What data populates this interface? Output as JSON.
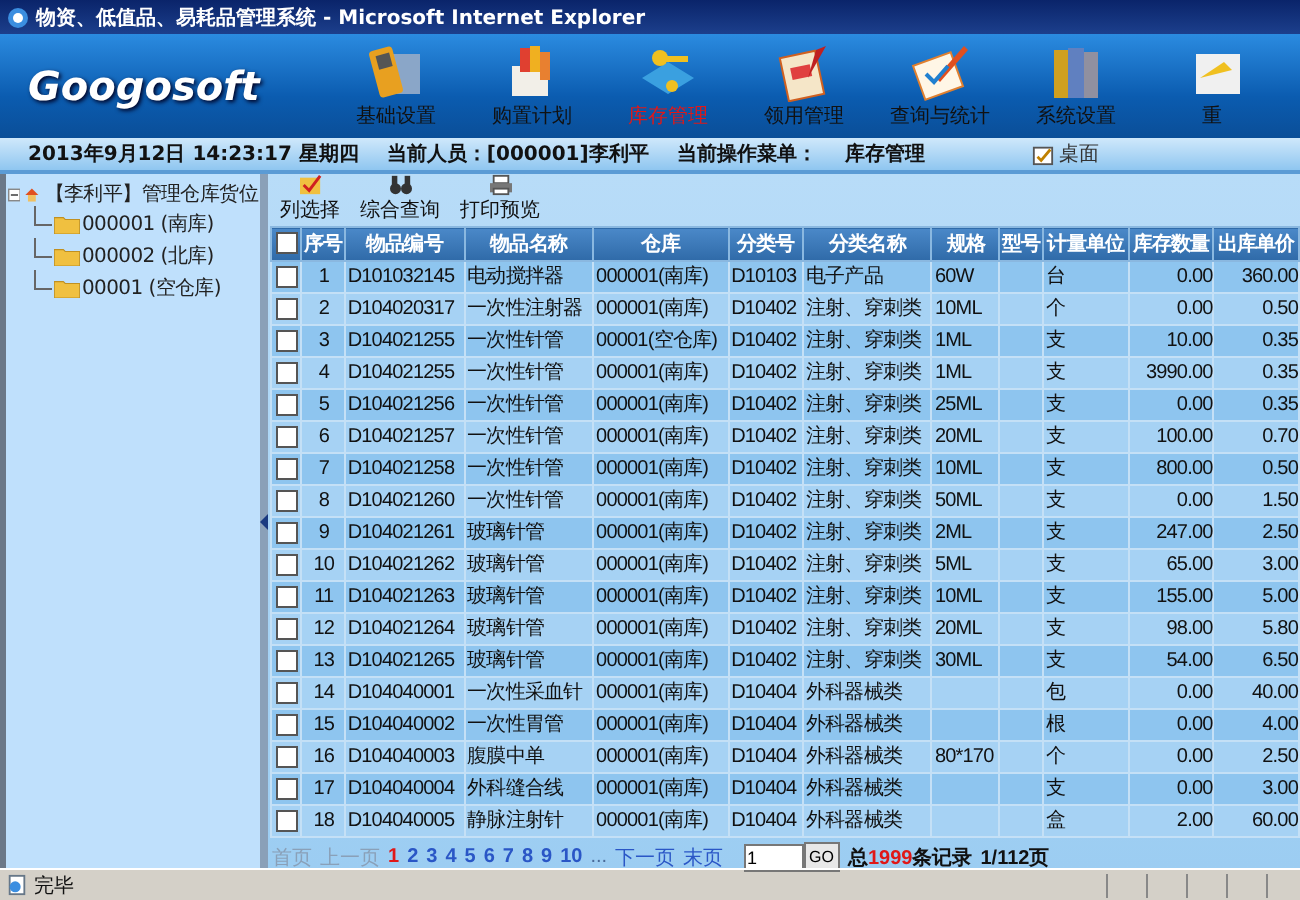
{
  "window": {
    "title": "物资、低值品、易耗品管理系统 - Microsoft Internet Explorer"
  },
  "logo": "Googosoft",
  "nav": [
    {
      "label": "基础设置",
      "selected": false
    },
    {
      "label": "购置计划",
      "selected": false
    },
    {
      "label": "库存管理",
      "selected": true
    },
    {
      "label": "领用管理",
      "selected": false
    },
    {
      "label": "查询与统计",
      "selected": false
    },
    {
      "label": "系统设置",
      "selected": false
    },
    {
      "label": "重",
      "selected": false
    }
  ],
  "info_bar": {
    "datetime": "2013年9月12日 14:23:17 星期四",
    "user": "当前人员：[000001]李利平",
    "menu_label": "当前操作菜单：",
    "menu_value": "库存管理",
    "desktop": "桌面"
  },
  "tree": {
    "label": "【李利平】管理仓库货位",
    "expanded": true,
    "children": [
      {
        "label": "000001 (南库)"
      },
      {
        "label": "000002 (北库)"
      },
      {
        "label": "00001 (空仓库)"
      }
    ]
  },
  "toolbar": [
    {
      "label": "列选择"
    },
    {
      "label": "综合查询"
    },
    {
      "label": "打印预览"
    }
  ],
  "table": {
    "all_checked": false,
    "columns": [
      "序号",
      "物品编号",
      "物品名称",
      "仓库",
      "分类号",
      "分类名称",
      "规格",
      "型号",
      "计量单位",
      "库存数量",
      "出库单价"
    ],
    "rows": [
      {
        "checked": false,
        "no": "1",
        "code": "D101032145",
        "name": "电动搅拌器",
        "warehouse": "000001(南库)",
        "cat_no": "D10103",
        "cat_name": "电子产品",
        "spec": "60W",
        "unit": "台",
        "qty": "0.00",
        "price": "360.00"
      },
      {
        "checked": false,
        "no": "2",
        "code": "D104020317",
        "name": "一次性注射器",
        "warehouse": "000001(南库)",
        "cat_no": "D10402",
        "cat_name": "注射、穿刺类",
        "spec": "10ML",
        "unit": "个",
        "qty": "0.00",
        "price": "0.50"
      },
      {
        "checked": false,
        "no": "3",
        "code": "D104021255",
        "name": "一次性针管",
        "warehouse": "00001(空仓库)",
        "cat_no": "D10402",
        "cat_name": "注射、穿刺类",
        "spec": "1ML",
        "unit": "支",
        "qty": "10.00",
        "price": "0.35"
      },
      {
        "checked": false,
        "no": "4",
        "code": "D104021255",
        "name": "一次性针管",
        "warehouse": "000001(南库)",
        "cat_no": "D10402",
        "cat_name": "注射、穿刺类",
        "spec": "1ML",
        "unit": "支",
        "qty": "3990.00",
        "price": "0.35"
      },
      {
        "checked": false,
        "no": "5",
        "code": "D104021256",
        "name": "一次性针管",
        "warehouse": "000001(南库)",
        "cat_no": "D10402",
        "cat_name": "注射、穿刺类",
        "spec": "25ML",
        "unit": "支",
        "qty": "0.00",
        "price": "0.35"
      },
      {
        "checked": false,
        "no": "6",
        "code": "D104021257",
        "name": "一次性针管",
        "warehouse": "000001(南库)",
        "cat_no": "D10402",
        "cat_name": "注射、穿刺类",
        "spec": "20ML",
        "unit": "支",
        "qty": "100.00",
        "price": "0.70"
      },
      {
        "checked": false,
        "no": "7",
        "code": "D104021258",
        "name": "一次性针管",
        "warehouse": "000001(南库)",
        "cat_no": "D10402",
        "cat_name": "注射、穿刺类",
        "spec": "10ML",
        "unit": "支",
        "qty": "800.00",
        "price": "0.50"
      },
      {
        "checked": false,
        "no": "8",
        "code": "D104021260",
        "name": "一次性针管",
        "warehouse": "000001(南库)",
        "cat_no": "D10402",
        "cat_name": "注射、穿刺类",
        "spec": "50ML",
        "unit": "支",
        "qty": "0.00",
        "price": "1.50"
      },
      {
        "checked": false,
        "no": "9",
        "code": "D104021261",
        "name": "玻璃针管",
        "warehouse": "000001(南库)",
        "cat_no": "D10402",
        "cat_name": "注射、穿刺类",
        "spec": "2ML",
        "unit": "支",
        "qty": "247.00",
        "price": "2.50"
      },
      {
        "checked": false,
        "no": "10",
        "code": "D104021262",
        "name": "玻璃针管",
        "warehouse": "000001(南库)",
        "cat_no": "D10402",
        "cat_name": "注射、穿刺类",
        "spec": "5ML",
        "unit": "支",
        "qty": "65.00",
        "price": "3.00"
      },
      {
        "checked": false,
        "no": "11",
        "code": "D104021263",
        "name": "玻璃针管",
        "warehouse": "000001(南库)",
        "cat_no": "D10402",
        "cat_name": "注射、穿刺类",
        "spec": "10ML",
        "unit": "支",
        "qty": "155.00",
        "price": "5.00"
      },
      {
        "checked": false,
        "no": "12",
        "code": "D104021264",
        "name": "玻璃针管",
        "warehouse": "000001(南库)",
        "cat_no": "D10402",
        "cat_name": "注射、穿刺类",
        "spec": "20ML",
        "unit": "支",
        "qty": "98.00",
        "price": "5.80"
      },
      {
        "checked": false,
        "no": "13",
        "code": "D104021265",
        "name": "玻璃针管",
        "warehouse": "000001(南库)",
        "cat_no": "D10402",
        "cat_name": "注射、穿刺类",
        "spec": "30ML",
        "unit": "支",
        "qty": "54.00",
        "price": "6.50"
      },
      {
        "checked": false,
        "no": "14",
        "code": "D104040001",
        "name": "一次性采血针",
        "warehouse": "000001(南库)",
        "cat_no": "D10404",
        "cat_name": "外科器械类",
        "unit": "包",
        "qty": "0.00",
        "price": "40.00"
      },
      {
        "checked": false,
        "no": "15",
        "code": "D104040002",
        "name": "一次性胃管",
        "warehouse": "000001(南库)",
        "cat_no": "D10404",
        "cat_name": "外科器械类",
        "unit": "根",
        "qty": "0.00",
        "price": "4.00"
      },
      {
        "checked": false,
        "no": "16",
        "code": "D104040003",
        "name": "腹膜中单",
        "warehouse": "000001(南库)",
        "cat_no": "D10404",
        "cat_name": "外科器械类",
        "spec": "80*170",
        "unit": "个",
        "qty": "0.00",
        "price": "2.50"
      },
      {
        "checked": false,
        "no": "17",
        "code": "D104040004",
        "name": "外科缝合线",
        "warehouse": "000001(南库)",
        "cat_no": "D10404",
        "cat_name": "外科器械类",
        "unit": "支",
        "qty": "0.00",
        "price": "3.00"
      },
      {
        "checked": false,
        "no": "18",
        "code": "D104040005",
        "name": "静脉注射针",
        "warehouse": "000001(南库)",
        "cat_no": "D10404",
        "cat_name": "外科器械类",
        "unit": "盒",
        "qty": "2.00",
        "price": "60.00"
      }
    ]
  },
  "pagination": {
    "first": {
      "label": "首页",
      "disabled": true
    },
    "prev": {
      "label": "上一页",
      "disabled": true
    },
    "pages": [
      {
        "label": "1",
        "selected": true
      },
      {
        "label": "2",
        "selected": false
      },
      {
        "label": "3",
        "selected": false
      },
      {
        "label": "4",
        "selected": false
      },
      {
        "label": "5",
        "selected": false
      },
      {
        "label": "6",
        "selected": false
      },
      {
        "label": "7",
        "selected": false
      },
      {
        "label": "8",
        "selected": false
      },
      {
        "label": "9",
        "selected": false
      },
      {
        "label": "10",
        "selected": false
      }
    ],
    "ellipsis": "...",
    "next": {
      "label": "下一页",
      "disabled": false
    },
    "last": {
      "label": "末页",
      "disabled": false
    },
    "page_input": "1",
    "go": "GO",
    "total_before": "总",
    "total_count": "1999",
    "total_after": "条记录",
    "page_info": "1/112页"
  },
  "status_bar": {
    "text": "完毕"
  }
}
